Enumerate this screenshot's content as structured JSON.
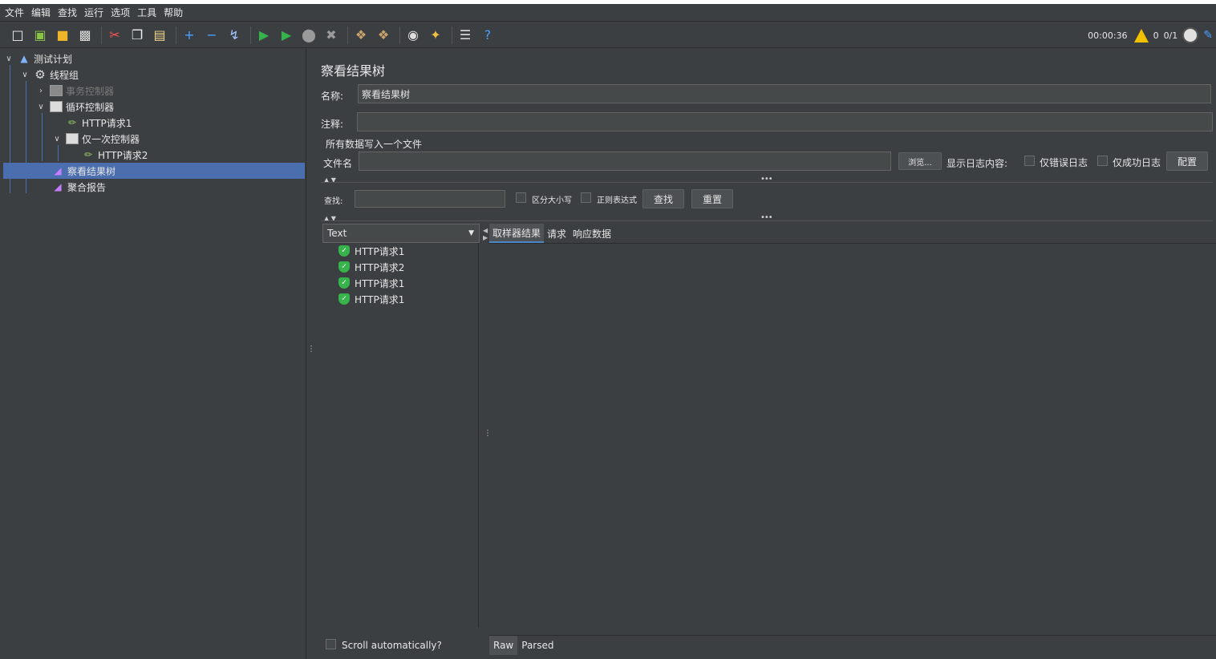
{
  "menubar": [
    "文件",
    "编辑",
    "查找",
    "运行",
    "选项",
    "工具",
    "帮助"
  ],
  "status": {
    "timer": "00:00:36",
    "warnings": "0",
    "threads": "0/1"
  },
  "tree": {
    "items": [
      {
        "label": "测试计划"
      },
      {
        "label": "线程组"
      },
      {
        "label": "事务控制器"
      },
      {
        "label": "循环控制器"
      },
      {
        "label": "HTTP请求1"
      },
      {
        "label": "仅一次控制器"
      },
      {
        "label": "HTTP请求2"
      },
      {
        "label": "察看结果树"
      },
      {
        "label": "聚合报告"
      }
    ]
  },
  "panel": {
    "title": "察看结果树",
    "name_label": "名称:",
    "name_value": "察看结果树",
    "comment_label": "注释:",
    "comment_value": "",
    "file_group_label": "所有数据写入一个文件",
    "filename_label": "文件名",
    "filename_value": "",
    "browse_label": "浏览...",
    "log_label": "显示日志内容:",
    "errors_only": "仅错误日志",
    "success_only": "仅成功日志",
    "config_label": "配置",
    "search_label": "查找:",
    "search_value": "",
    "case_label": "区分大小写",
    "regex_label": "正则表达式",
    "find_btn": "查找",
    "reset_btn": "重置"
  },
  "results": {
    "renderer": "Text",
    "items": [
      "HTTP请求1",
      "HTTP请求2",
      "HTTP请求1",
      "HTTP请求1"
    ],
    "scroll_label": "Scroll automatically?"
  },
  "tabs": [
    "取样器结果",
    "请求",
    "响应数据"
  ],
  "bottom_tabs": [
    "Raw",
    "Parsed"
  ]
}
